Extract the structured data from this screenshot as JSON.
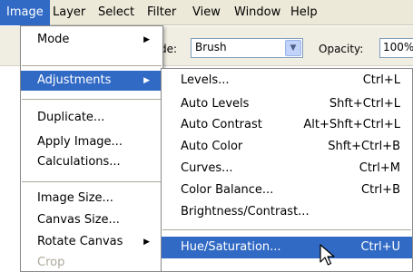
{
  "menubar": {
    "items": [
      "Image",
      "Layer",
      "Select",
      "Filter",
      "View",
      "Window",
      "Help"
    ]
  },
  "options_bar": {
    "mode_label": "de:",
    "brush_value": "Brush",
    "opacity_label": "Opacity:",
    "opacity_value": "100%"
  },
  "image_menu": {
    "mode": "Mode",
    "adjustments": "Adjustments",
    "duplicate": "Duplicate...",
    "apply_image": "Apply Image...",
    "calculations": "Calculations...",
    "image_size": "Image Size...",
    "canvas_size": "Canvas Size...",
    "rotate_canvas": "Rotate Canvas",
    "crop": "Crop"
  },
  "adjustments_menu": {
    "items": [
      {
        "label": "Levels...",
        "shortcut": "Ctrl+L"
      },
      {
        "label": "Auto Levels",
        "shortcut": "Shft+Ctrl+L"
      },
      {
        "label": "Auto Contrast",
        "shortcut": "Alt+Shft+Ctrl+L"
      },
      {
        "label": "Auto Color",
        "shortcut": "Shft+Ctrl+B"
      },
      {
        "label": "Curves...",
        "shortcut": "Ctrl+M"
      },
      {
        "label": "Color Balance...",
        "shortcut": "Ctrl+B"
      },
      {
        "label": "Brightness/Contrast...",
        "shortcut": ""
      },
      {
        "label": "Hue/Saturation...",
        "shortcut": "Ctrl+U"
      }
    ]
  },
  "colors": {
    "highlight": "#316ac5",
    "menubar_bg": "#ece9d8",
    "disabled_text": "#aca899"
  },
  "icons": [
    "submenu-arrow-icon",
    "dropdown-arrow-icon",
    "mouse-pointer-icon"
  ]
}
